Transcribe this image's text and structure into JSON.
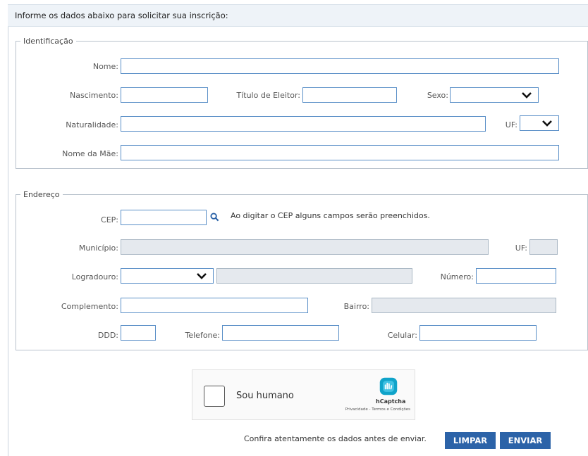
{
  "header": {
    "title": "Informe os dados abaixo para solicitar sua inscrição:"
  },
  "identificacao": {
    "legend": "Identificação",
    "nome_label": "Nome:",
    "nascimento_label": "Nascimento:",
    "titulo_label": "Título de Eleitor:",
    "sexo_label": "Sexo:",
    "naturalidade_label": "Naturalidade:",
    "uf_label": "UF:",
    "mae_label": "Nome da Mãe:"
  },
  "endereco": {
    "legend": "Endereço",
    "cep_label": "CEP:",
    "cep_hint": "Ao digitar o CEP alguns campos serão preenchidos.",
    "municipio_label": "Município:",
    "uf_label": "UF:",
    "logradouro_label": "Logradouro:",
    "numero_label": "Número:",
    "complemento_label": "Complemento:",
    "bairro_label": "Bairro:",
    "ddd_label": "DDD:",
    "telefone_label": "Telefone:",
    "celular_label": "Celular:"
  },
  "captcha": {
    "label": "Sou humano",
    "brand": "hCaptcha",
    "links": "Privacidade - Termos e Condições"
  },
  "footer": {
    "notice": "Confira atentamente os dados antes de enviar.",
    "limpar": "LIMPAR",
    "enviar": "ENVIAR"
  },
  "icons": {
    "search": "search-icon",
    "chevron": "chevron-down-icon",
    "hcaptcha": "hcaptcha-logo-icon"
  },
  "colors": {
    "accent": "#2c63a8",
    "input_border": "#5a8fc7",
    "disabled_bg": "#e5e9ee",
    "header_bg": "#eef3f8"
  }
}
